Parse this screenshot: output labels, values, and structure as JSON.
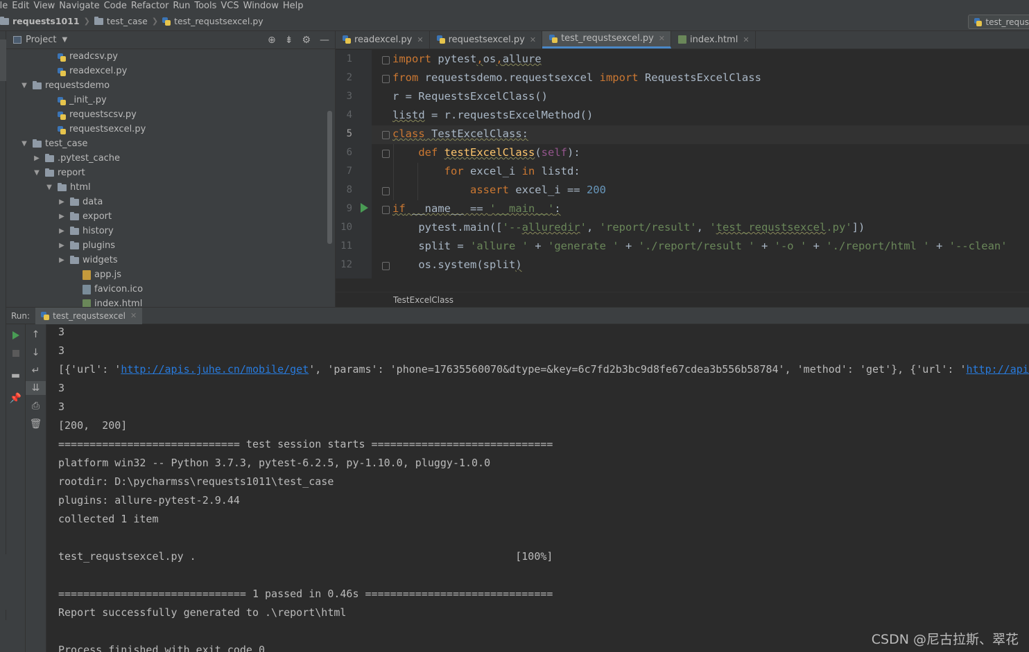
{
  "menu": [
    "ile",
    "Edit",
    "View",
    "Navigate",
    "Code",
    "Refactor",
    "Run",
    "Tools",
    "VCS",
    "Window",
    "Help"
  ],
  "breadcrumbs": {
    "project": "requests1011",
    "folder": "test_case",
    "file": "test_requstsexcel.py"
  },
  "run_config": "test_requs",
  "project_panel": {
    "title": "Project",
    "tree": [
      {
        "label": "readcsv.py",
        "type": "py",
        "depth": 3
      },
      {
        "label": "readexcel.py",
        "type": "py",
        "depth": 3
      },
      {
        "label": "requestsdemo",
        "type": "folder",
        "depth": 1,
        "expanded": true
      },
      {
        "label": "_init_.py",
        "type": "py",
        "depth": 3
      },
      {
        "label": "requestscsv.py",
        "type": "py",
        "depth": 3
      },
      {
        "label": "requestsexcel.py",
        "type": "py",
        "depth": 3
      },
      {
        "label": "test_case",
        "type": "folder",
        "depth": 1,
        "expanded": true
      },
      {
        "label": ".pytest_cache",
        "type": "folder",
        "depth": 2,
        "expanded": false
      },
      {
        "label": "report",
        "type": "folder",
        "depth": 2,
        "expanded": true
      },
      {
        "label": "html",
        "type": "folder",
        "depth": 3,
        "expanded": true
      },
      {
        "label": "data",
        "type": "folder",
        "depth": 4,
        "expanded": false
      },
      {
        "label": "export",
        "type": "folder",
        "depth": 4,
        "expanded": false
      },
      {
        "label": "history",
        "type": "folder",
        "depth": 4,
        "expanded": false
      },
      {
        "label": "plugins",
        "type": "folder",
        "depth": 4,
        "expanded": false
      },
      {
        "label": "widgets",
        "type": "folder",
        "depth": 4,
        "expanded": false
      },
      {
        "label": "app.js",
        "type": "js",
        "depth": 5
      },
      {
        "label": "favicon.ico",
        "type": "ico",
        "depth": 5
      },
      {
        "label": "index.html",
        "type": "html",
        "depth": 5
      }
    ]
  },
  "editor": {
    "tabs": [
      {
        "label": "readexcel.py",
        "icon": "python-file-icon",
        "active": false
      },
      {
        "label": "requestsexcel.py",
        "icon": "python-file-icon",
        "active": false
      },
      {
        "label": "test_requstsexcel.py",
        "icon": "python-file-icon",
        "active": true
      },
      {
        "label": "index.html",
        "icon": "html-file-icon",
        "active": false
      }
    ],
    "line_numbers": [
      "1",
      "2",
      "3",
      "4",
      "5",
      "6",
      "7",
      "8",
      "9",
      "10",
      "11",
      "12"
    ],
    "current_line": "5",
    "structure_breadcrumb": "TestExcelClass"
  },
  "run_panel": {
    "label": "Run:",
    "tab": "test_requstsexcel",
    "output": [
      "3",
      "3",
      "",
      "3",
      "3",
      "[200,  200]",
      "============================= test session starts =============================",
      "platform win32 -- Python 3.7.3, pytest-6.2.5, py-1.10.0, pluggy-1.0.0",
      "rootdir: D:\\pycharmss\\requests1011\\test_case",
      "plugins: allure-pytest-2.9.44",
      "collected 1 item",
      "",
      "test_requstsexcel.py .                                                   [100%]",
      "",
      "============================== 1 passed in 0.46s ==============================",
      "Report successfully generated to .\\report\\html",
      "",
      "Process finished with exit code 0"
    ],
    "params_line": {
      "prefix": "[{'url': '",
      "url1": "http://apis.juhe.cn/mobile/get",
      "middle": "', 'params': 'phone=17635560070&dtype=&key=6c7fd2b3bc9d8fe67cdea3b556b58784', 'method': 'get'}, {'url': '",
      "url2": "http://apis"
    }
  },
  "watermark": "CSDN @尼古拉斯、翠花",
  "colors": {
    "keyword": "#cc7832",
    "string": "#6a8759",
    "number": "#6897bb",
    "function": "#ffc66d",
    "self": "#94558d",
    "link": "#287bde",
    "run_green": "#499c54"
  }
}
